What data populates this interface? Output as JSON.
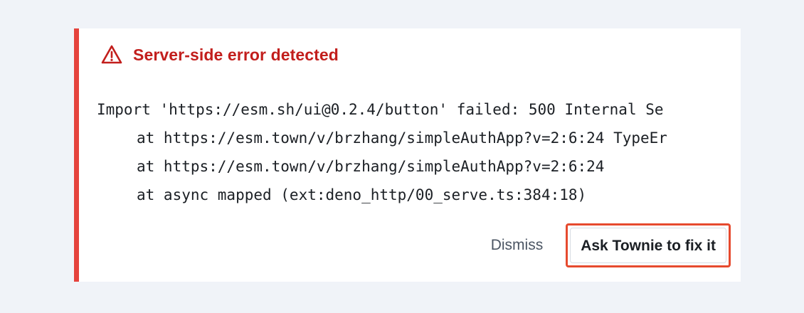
{
  "error": {
    "title": "Server-side error detected",
    "icon": "warning-triangle-icon",
    "accent_color": "#e5433d",
    "title_color": "#c21e1c",
    "trace": [
      "Import 'https://esm.sh/ui@0.2.4/button' failed: 500 Internal Se",
      "at https://esm.town/v/brzhang/simpleAuthApp?v=2:6:24 TypeEr",
      "at https://esm.town/v/brzhang/simpleAuthApp?v=2:6:24",
      "at async mapped (ext:deno_http/00_serve.ts:384:18)"
    ]
  },
  "actions": {
    "dismiss_label": "Dismiss",
    "fix_label": "Ask Townie to fix it",
    "highlight_color": "#e64a2e"
  }
}
